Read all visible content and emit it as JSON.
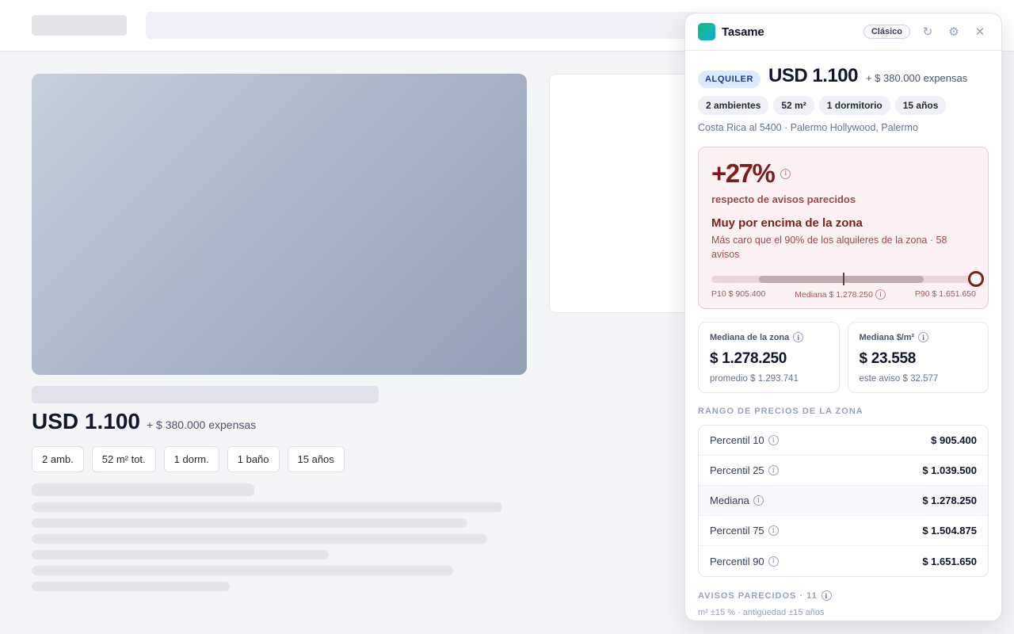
{
  "listing": {
    "price": "USD 1.100",
    "expenses": "+ $ 380.000 expensas",
    "chips": [
      "2 amb.",
      "52 m² tot.",
      "1 dorm.",
      "1 baño",
      "15 años"
    ]
  },
  "panel": {
    "app_name": "Tasame",
    "mode_label": "Clásico",
    "icons": {
      "refresh": "refresh-icon",
      "settings": "gear-icon",
      "close": "close-icon",
      "logo": "app-logo"
    },
    "operation_tag": "ALQUILER",
    "price": "USD 1.100",
    "expenses": "+ $ 380.000 expensas",
    "features": [
      "2 ambientes",
      "52 m²",
      "1 dormitorio",
      "15 años"
    ],
    "address": "Costa Rica al 5400 · Palermo Hollywood, Palermo",
    "verdict": {
      "percent": "+27%",
      "subtitle": "respecto de avisos parecidos",
      "headline": "Muy por encima de la zona",
      "description": "Más caro que el 90% de los alquileres de la zona · 58 avisos",
      "p10_label": "P10 $ 905.400",
      "median_label": "Mediana $ 1.278.250",
      "p90_label": "P90 $ 1.651.650",
      "scale": {
        "p10": 905400,
        "p25": 1039500,
        "median": 1278250,
        "p75": 1504875,
        "p90": 1651650,
        "listing": 1651650
      },
      "colors": {
        "accent": "#7f1d1d",
        "background": "#fdf2f2"
      }
    },
    "cards": [
      {
        "label": "Mediana de la zona",
        "value": "$ 1.278.250",
        "note": "promedio $ 1.293.741"
      },
      {
        "label": "Mediana $/m²",
        "value": "$ 23.558",
        "note": "este aviso $ 32.577"
      }
    ],
    "range_title": "RANGO DE PRECIOS DE LA ZONA",
    "range_rows": [
      {
        "label": "Percentil 10",
        "value": "$ 905.400"
      },
      {
        "label": "Percentil 25",
        "value": "$ 1.039.500"
      },
      {
        "label": "Mediana",
        "value": "$ 1.278.250"
      },
      {
        "label": "Percentil 75",
        "value": "$ 1.504.875"
      },
      {
        "label": "Percentil 90",
        "value": "$ 1.651.650"
      }
    ],
    "similar_title": "AVISOS PARECIDOS · 11",
    "similar_criteria": "m² ±15 % · antigüedad ±15 años"
  }
}
